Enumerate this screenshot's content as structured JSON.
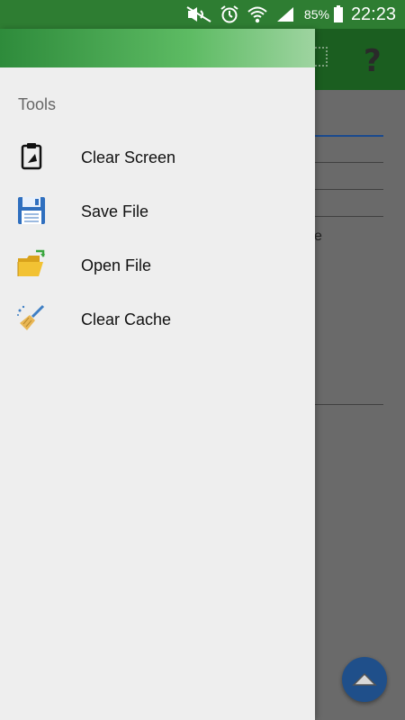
{
  "status_bar": {
    "battery": "85%",
    "time": "22:23",
    "icons": [
      "mute-icon",
      "alarm-icon",
      "wifi-icon",
      "signal-icon",
      "battery-icon"
    ]
  },
  "background_app": {
    "toolbar_icons": [
      "view-icon",
      "help-icon"
    ],
    "help_glyph": "?",
    "partial_text": "e"
  },
  "drawer": {
    "section_title": "Tools",
    "items": [
      {
        "label": "Clear Screen",
        "icon": "clipboard-icon"
      },
      {
        "label": "Save File",
        "icon": "floppy-disk-icon"
      },
      {
        "label": "Open File",
        "icon": "folder-open-icon"
      },
      {
        "label": "Clear Cache",
        "icon": "broom-icon"
      }
    ]
  },
  "fab": {
    "icon": "chevron-up-icon"
  },
  "colors": {
    "status_bar": "#2e7d32",
    "drawer_header_start": "#2e8b3b",
    "drawer_header_end": "#9ed4a0",
    "drawer_bg": "#eeeeee",
    "fab": "#1f4f8a"
  }
}
